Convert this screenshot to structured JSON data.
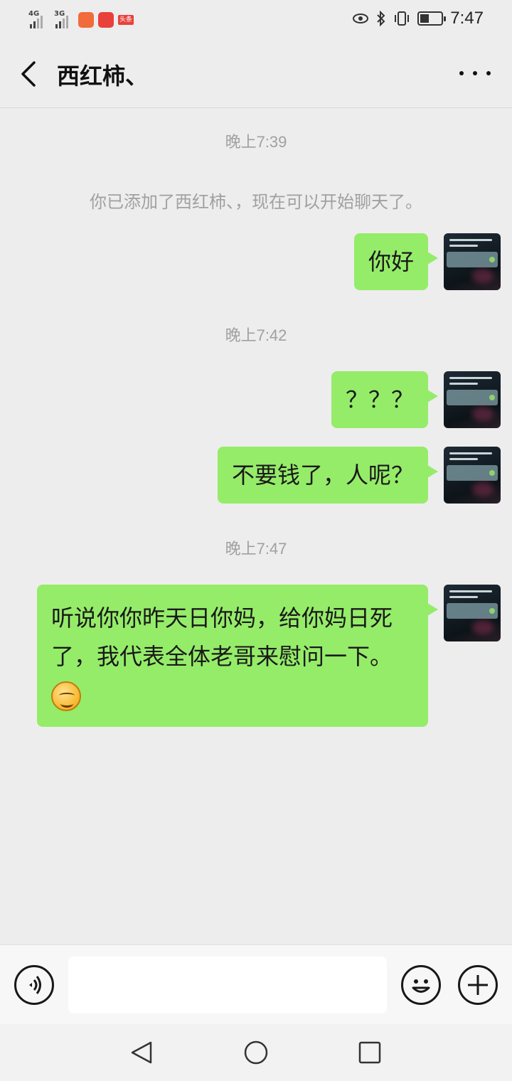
{
  "status_bar": {
    "signal1_label": "4G",
    "signal2_label": "3G",
    "app3_label": "头条",
    "time": "7:47"
  },
  "header": {
    "title": "西红柿、"
  },
  "messages": {
    "time1": "晚上7:39",
    "system_notice": "你已添加了西红柿、，现在可以开始聊天了。",
    "msg1": "你好",
    "time2": "晚上7:42",
    "msg2": "？？？",
    "msg3": "不要钱了，人呢？",
    "time3": "晚上7:47",
    "msg4": "听说你你昨天日你妈，给你妈日死了，我代表全体老哥来慰问一下。",
    "msg4_emoji": "smirk-emoji"
  },
  "input_bar": {
    "voice_icon": "voice-icon",
    "emoji_icon": "smiley-icon",
    "plus_icon": "plus-icon",
    "value": ""
  },
  "nav": {
    "back_icon": "triangle-back-icon",
    "home_icon": "circle-home-icon",
    "recents_icon": "square-recents-icon"
  },
  "colors": {
    "bubble": "#95ec69",
    "background": "#ededed"
  }
}
